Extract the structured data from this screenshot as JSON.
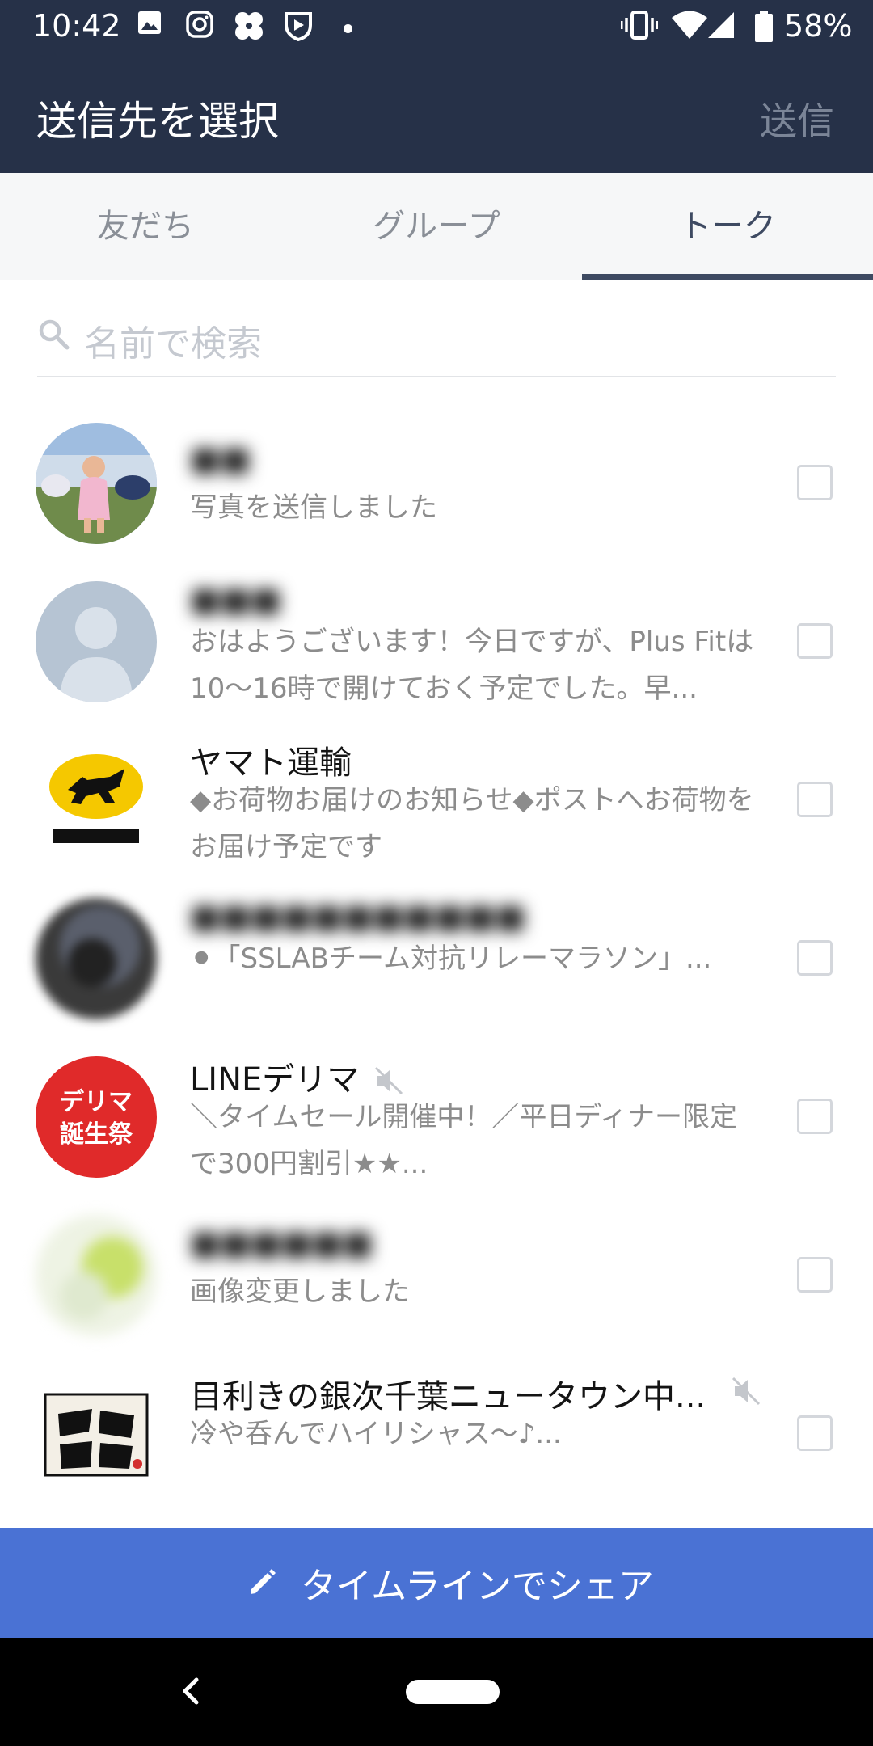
{
  "status_bar": {
    "time": "10:42",
    "battery": "58%",
    "icons": [
      "image-icon",
      "instagram-icon",
      "pinwheel-icon",
      "play-shield-icon",
      "vibrate-icon",
      "wifi-icon",
      "signal-icon",
      "battery-icon"
    ]
  },
  "header": {
    "title": "送信先を選択",
    "send_label": "送信",
    "bg_color": "#263148"
  },
  "tabs": [
    {
      "label": "友だち",
      "active": false
    },
    {
      "label": "グループ",
      "active": false
    },
    {
      "label": "トーク",
      "active": true
    }
  ],
  "search": {
    "placeholder": "名前で検索",
    "value": ""
  },
  "chats": [
    {
      "name": "",
      "blurred": true,
      "message": "写真を送信しました",
      "muted": false,
      "checked": false,
      "avatar": "photo-child"
    },
    {
      "name": "",
      "blurred": true,
      "message": "おはようございます！今日ですが、Plus Fitは10〜16時で開けておく予定でした。早...",
      "muted": false,
      "checked": false,
      "avatar": "default-person"
    },
    {
      "name": "ヤマト運輸",
      "blurred": false,
      "message": "◆お荷物お届けのお知らせ◆ポストへお荷物をお届け予定です",
      "muted": false,
      "checked": false,
      "avatar": "yamato-logo"
    },
    {
      "name": "",
      "blurred": true,
      "message": "⚫「SSLABチーム対抗リレーマラソン」...",
      "muted": false,
      "checked": false,
      "avatar": "dark-photo"
    },
    {
      "name": "LINEデリマ",
      "blurred": false,
      "message": "＼タイムセール開催中！／平日ディナー限定で300円割引★★...",
      "muted": true,
      "checked": false,
      "avatar": "delima-logo"
    },
    {
      "name": "",
      "blurred": true,
      "message": "画像変更しました",
      "muted": false,
      "checked": false,
      "avatar": "green-photo"
    },
    {
      "name": "目利きの銀次千葉ニュータウン中...",
      "blurred": false,
      "message": "冷や呑んでハイリシャス〜♪...",
      "muted": true,
      "checked": false,
      "avatar": "ginji-logo"
    }
  ],
  "share_button": {
    "label": "タイムラインでシェア",
    "color": "#4a72d4"
  },
  "nav_bar": {
    "back_icon": "back-icon",
    "home_icon": "home-pill-icon"
  }
}
